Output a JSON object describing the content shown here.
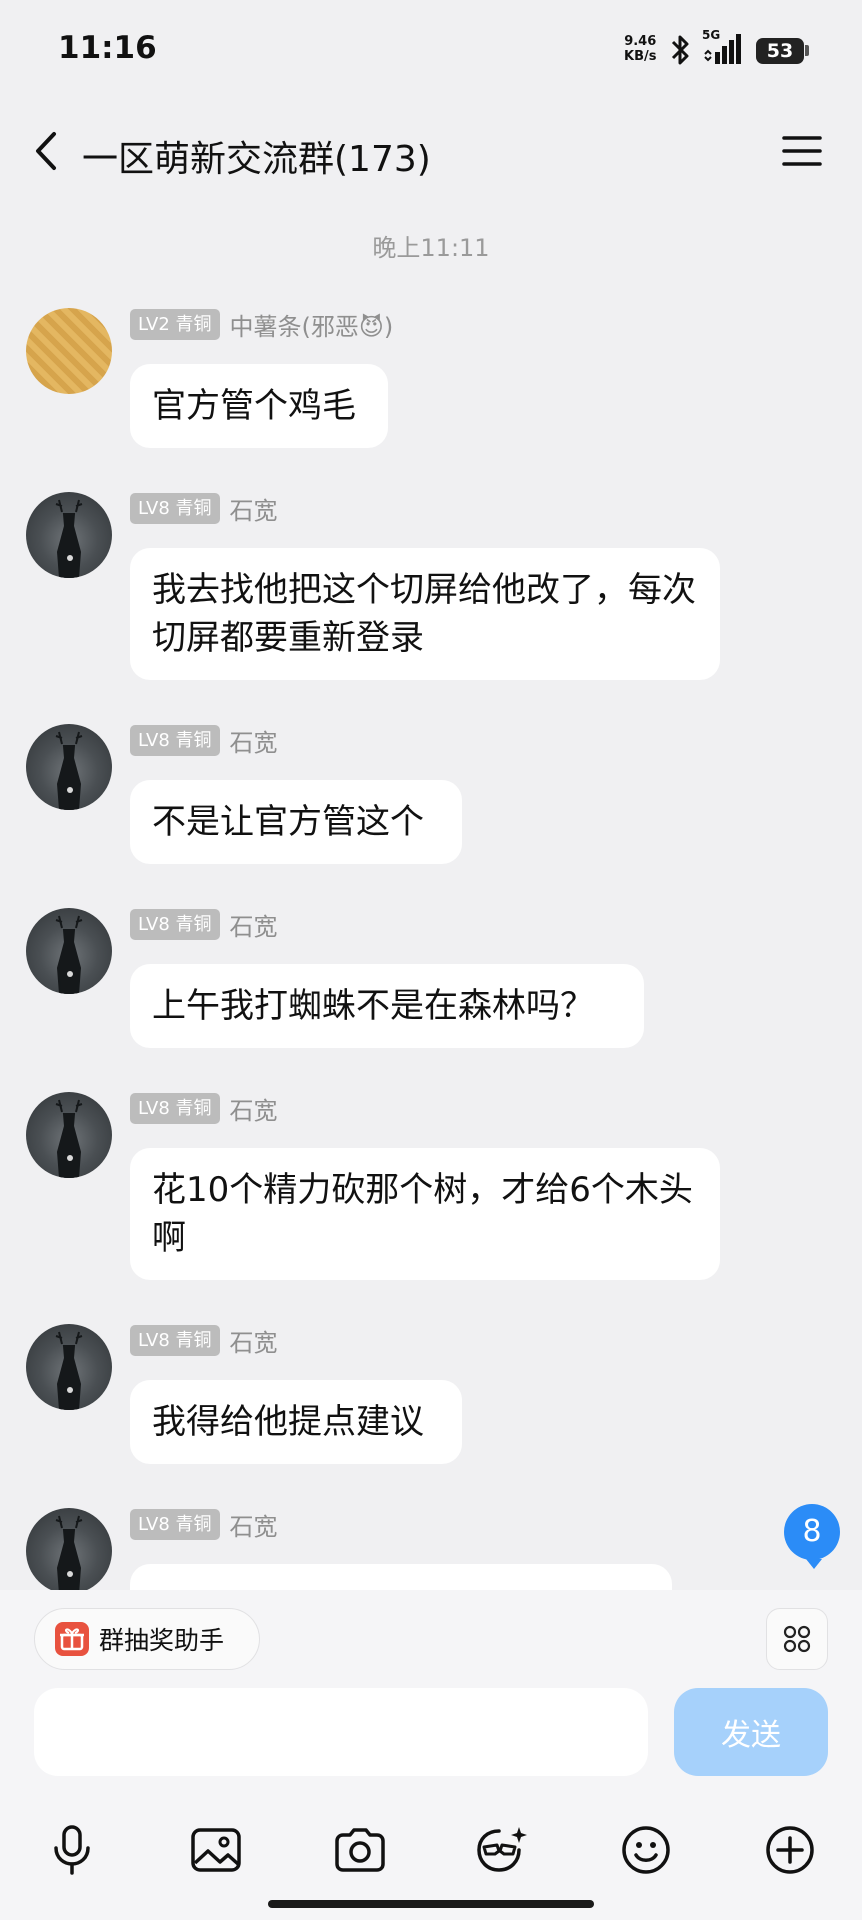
{
  "status_bar": {
    "time": "11:16",
    "net_speed_value": "9.46",
    "net_speed_unit": "KB/s",
    "signal_label": "5G",
    "battery": "53"
  },
  "header": {
    "title": "一区萌新交流群(173)"
  },
  "time_divider": "晚上11:11",
  "messages": [
    {
      "level": "LV2 青铜",
      "sender": "中薯条(邪恶😈)",
      "text": "官方管个鸡毛"
    },
    {
      "level": "LV8 青铜",
      "sender": "石宽",
      "text": "我去找他把这个切屏给他改了，每次切屏都要重新登录"
    },
    {
      "level": "LV8 青铜",
      "sender": "石宽",
      "text": "不是让官方管这个"
    },
    {
      "level": "LV8 青铜",
      "sender": "石宽",
      "text": "上午我打蜘蛛不是在森林吗？"
    },
    {
      "level": "LV8 青铜",
      "sender": "石宽",
      "text": "花10个精力砍那个树，才给6个木头啊"
    },
    {
      "level": "LV8 青铜",
      "sender": "石宽",
      "text": "我得给他提点建议"
    },
    {
      "level": "LV8 青铜",
      "sender": "石宽",
      "text": ""
    }
  ],
  "unread_count": "8",
  "bottom": {
    "assistant_label": "群抽奖助手",
    "input_placeholder": "",
    "send_label": "发送"
  },
  "colors": {
    "background": "#f0f0f2",
    "accent": "#2b8cf7",
    "send_disabled": "#a6d1fb",
    "level_badge": "#bcbcbc"
  },
  "icons": [
    "back-icon",
    "menu-icon",
    "gift-icon",
    "apps-icon",
    "microphone-icon",
    "image-icon",
    "camera-icon",
    "sticker-icon",
    "emoji-icon",
    "plus-icon"
  ]
}
